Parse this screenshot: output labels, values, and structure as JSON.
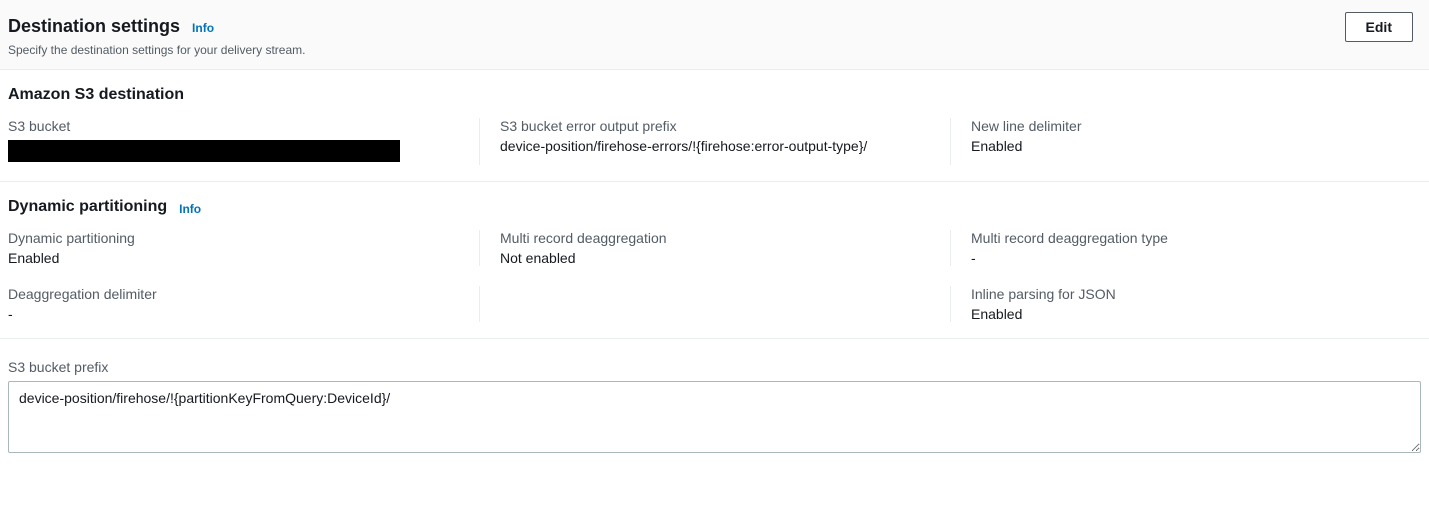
{
  "header": {
    "title": "Destination settings",
    "info": "Info",
    "subtitle": "Specify the destination settings for your delivery stream.",
    "edit_label": "Edit"
  },
  "s3_destination": {
    "title": "Amazon S3 destination",
    "fields": {
      "bucket_label": "S3 bucket",
      "error_prefix_label": "S3 bucket error output prefix",
      "error_prefix_value": "device-position/firehose-errors/!{firehose:error-output-type}/",
      "newline_label": "New line delimiter",
      "newline_value": "Enabled"
    }
  },
  "dynamic_partitioning": {
    "title": "Dynamic partitioning",
    "info": "Info",
    "fields": {
      "dp_label": "Dynamic partitioning",
      "dp_value": "Enabled",
      "multi_deagg_label": "Multi record deaggregation",
      "multi_deagg_value": "Not enabled",
      "multi_deagg_type_label": "Multi record deaggregation type",
      "multi_deagg_type_value": "-",
      "deagg_delim_label": "Deaggregation delimiter",
      "deagg_delim_value": "-",
      "inline_json_label": "Inline parsing for JSON",
      "inline_json_value": "Enabled"
    }
  },
  "s3_prefix": {
    "label": "S3 bucket prefix",
    "value": "device-position/firehose/!{partitionKeyFromQuery:DeviceId}/"
  }
}
